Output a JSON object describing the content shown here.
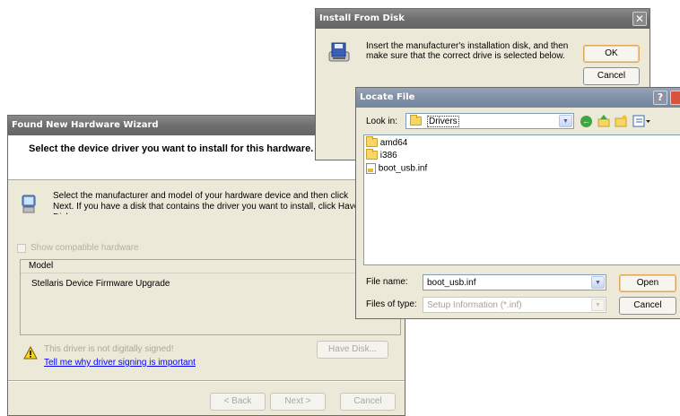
{
  "wizard": {
    "title": "Found New Hardware Wizard",
    "header": "Select the device driver you want to install for this hardware.",
    "instruction": "Select the manufacturer and model of your hardware device and then click Next. If you have a disk that contains the driver you want to install, click Have Disk.",
    "show_compatible_label": "Show compatible hardware",
    "model_header": "Model",
    "model_items": [
      "Stellaris Device Firmware Upgrade"
    ],
    "warning_text": "This driver is not digitally signed!",
    "signing_link": "Tell me why driver signing is important",
    "have_disk_label": "Have Disk...",
    "back_label": "< Back",
    "next_label": "Next >",
    "cancel_label": "Cancel"
  },
  "install_from_disk": {
    "title": "Install From Disk",
    "message": "Insert the manufacturer's installation disk, and then make sure that the correct drive is selected below.",
    "ok_label": "OK",
    "cancel_label": "Cancel"
  },
  "locate_file": {
    "title": "Locate File",
    "look_in_label": "Look in:",
    "look_in_value": "Drivers",
    "files": [
      {
        "name": "amd64",
        "icon": "folder-icon"
      },
      {
        "name": "i386",
        "icon": "folder-icon"
      },
      {
        "name": "boot_usb.inf",
        "icon": "setup-information-file-icon"
      }
    ],
    "file_name_label": "File name:",
    "file_name_value": "boot_usb.inf",
    "files_of_type_label": "Files of type:",
    "files_of_type_value": "Setup Information (*.inf)",
    "open_label": "Open",
    "cancel_label": "Cancel",
    "help_glyph": "?"
  },
  "colors": {
    "dialog_face": "#ece9d8",
    "inactive_titlebar": "#6e6e6e",
    "close_button": "#d9533c",
    "link": "#0000ff"
  }
}
